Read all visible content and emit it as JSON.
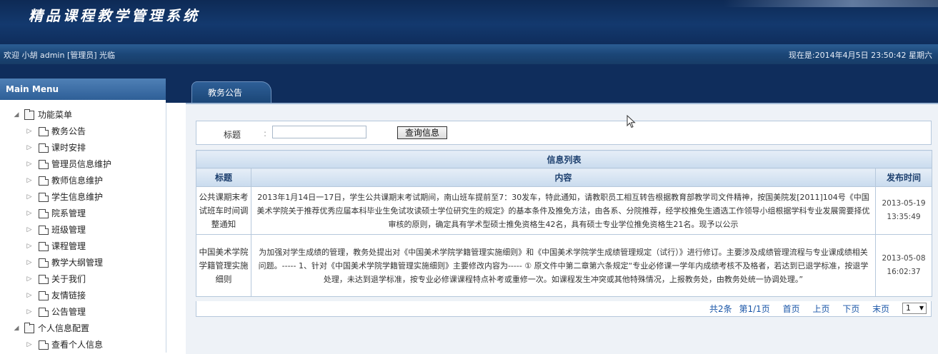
{
  "header": {
    "title": "精品课程教学管理系统",
    "welcome": "欢迎 小胡  admin [管理员] 光临",
    "datetime": "现在是:2014年4月5日 23:50:42 星期六"
  },
  "sidebar": {
    "menu_title": "Main Menu",
    "groups": [
      {
        "label": "功能菜单",
        "items": [
          "教务公告",
          "课时安排",
          "管理员信息维护",
          "教师信息维护",
          "学生信息维护",
          "院系管理",
          "班级管理",
          "课程管理",
          "教学大纲管理",
          "关于我们",
          "友情链接",
          "公告管理"
        ]
      },
      {
        "label": "个人信息配置",
        "items": [
          "查看个人信息"
        ]
      }
    ]
  },
  "tab": {
    "label": "教务公告"
  },
  "search": {
    "label": "标题",
    "colon": ":",
    "value": "",
    "button": "查询信息"
  },
  "table": {
    "caption": "信息列表",
    "columns": [
      "标题",
      "内容",
      "发布时间"
    ],
    "rows": [
      {
        "title": "公共课期末考试班车时间调整通知",
        "content": "2013年1月14日一17日，学生公共课期末考试期间，南山班车提前至7：30发车，特此通知，请教职员工相互转告根据教育部教学司文件精神，按国美院发[2011]104号《中国美术学院关于推荐优秀应届本科毕业生免试攻读硕士学位研究生的规定》的基本条件及推免方法，由各系、分院推荐，经学校推免生遴选工作领导小组根据学科专业发展需要择优审核的原则，确定具有学术型硕士推免资格生42名，具有硕士专业学位推免资格生21名。现予以公示",
        "date": "2013-05-19",
        "time": "13:35:49"
      },
      {
        "title": "中国美术学院学籍管理实施细则",
        "content": "为加强对学生成绩的管理，教务处提出对《中国美术学院学籍管理实施细则》和《中国美术学院学生成绩管理规定（试行）》进行修订。主要涉及成绩管理流程与专业课成绩相关问题。----- 1、针对《中国美术学院学籍管理实施细则》主要修改内容为----- ① 原文件中第二章第六条规定“专业必修课一学年内成绩考核不及格者，若达到已退学标准，按退学处理，未达到退学标准，按专业必修课课程特点补考或重修一次。如课程发生冲突或其他特殊情况，上报教务处，由教务处统一协调处理。”",
        "date": "2013-05-08",
        "time": "16:02:37"
      }
    ]
  },
  "pager": {
    "total": "共2条",
    "page": "第1/1页",
    "first": "首页",
    "prev": "上页",
    "next": "下页",
    "last": "末页",
    "selected": "1"
  }
}
